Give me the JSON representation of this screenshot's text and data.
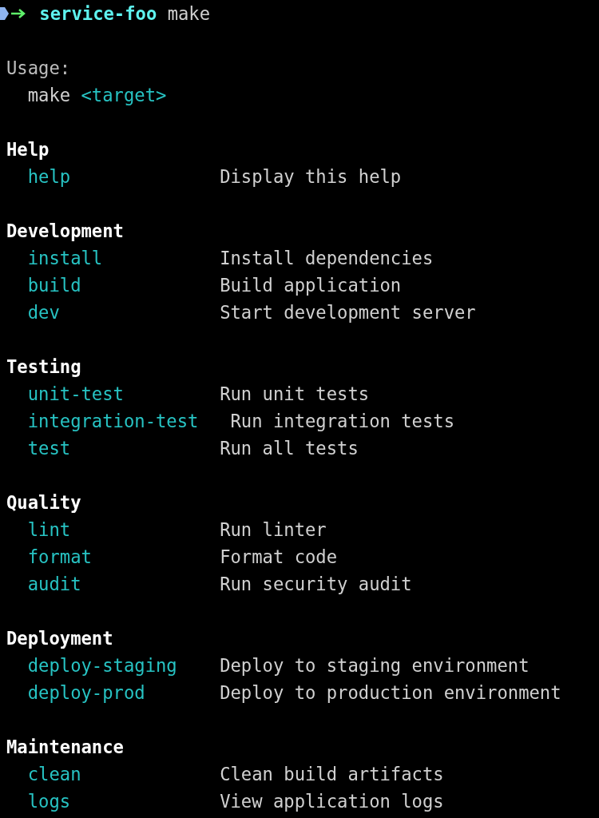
{
  "prompt": {
    "directory": "service-foo",
    "command": "make"
  },
  "usage": {
    "label": "Usage:",
    "command": "make",
    "argument": "<target>"
  },
  "sections": [
    {
      "title": "Help",
      "targets": [
        {
          "name": "help",
          "description": "Display this help"
        }
      ]
    },
    {
      "title": "Development",
      "targets": [
        {
          "name": "install",
          "description": "Install dependencies"
        },
        {
          "name": "build",
          "description": "Build application"
        },
        {
          "name": "dev",
          "description": "Start development server"
        }
      ]
    },
    {
      "title": "Testing",
      "targets": [
        {
          "name": "unit-test",
          "description": "Run unit tests"
        },
        {
          "name": "integration-test",
          "description": "Run integration tests"
        },
        {
          "name": "test",
          "description": "Run all tests"
        }
      ]
    },
    {
      "title": "Quality",
      "targets": [
        {
          "name": "lint",
          "description": "Run linter"
        },
        {
          "name": "format",
          "description": "Format code"
        },
        {
          "name": "audit",
          "description": "Run security audit"
        }
      ]
    },
    {
      "title": "Deployment",
      "targets": [
        {
          "name": "deploy-staging",
          "description": "Deploy to staging environment"
        },
        {
          "name": "deploy-prod",
          "description": "Deploy to production environment"
        }
      ]
    },
    {
      "title": "Maintenance",
      "targets": [
        {
          "name": "clean",
          "description": "Clean build artifacts"
        },
        {
          "name": "logs",
          "description": "View application logs"
        }
      ]
    }
  ]
}
